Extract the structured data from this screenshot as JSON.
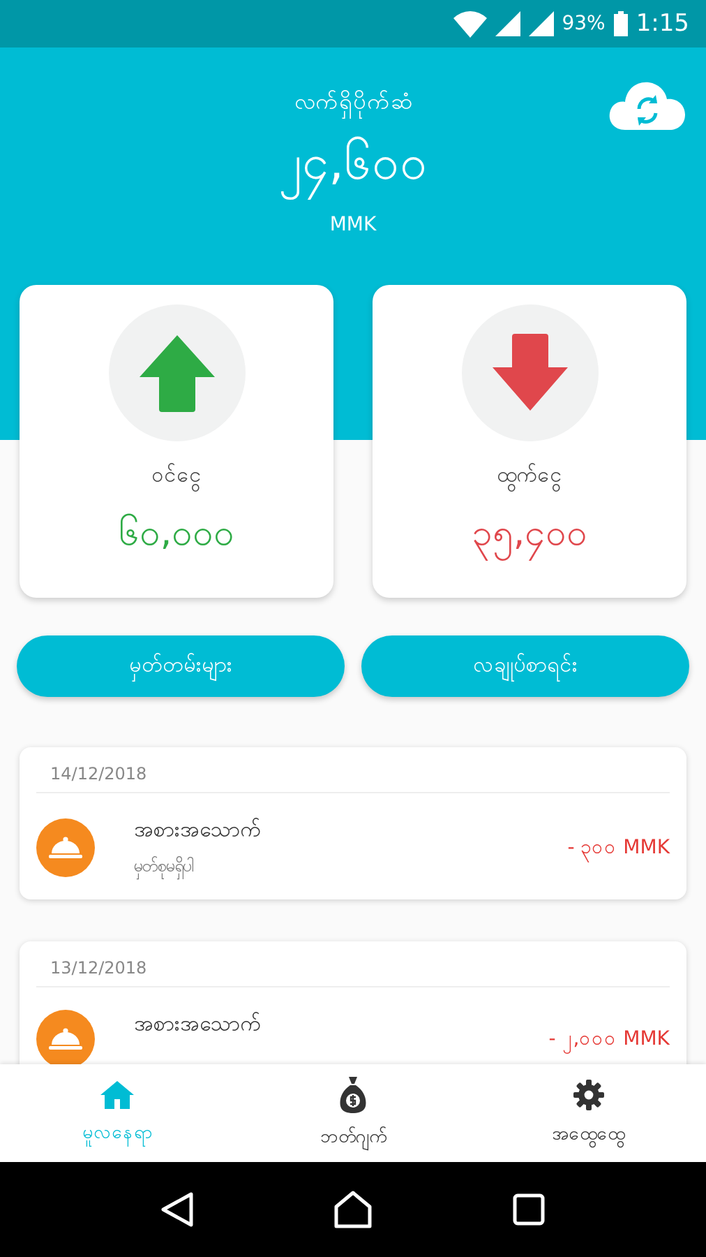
{
  "status_bar": {
    "battery": "93%",
    "time": "1:15"
  },
  "balance": {
    "label": "လက်ရှိပိုက်ဆံ",
    "amount": "၂၄,၆၀၀",
    "currency": "MMK"
  },
  "summary": [
    {
      "kind": "income",
      "label": "ဝင်ငွေ",
      "amount": "၆၀,၀၀၀"
    },
    {
      "kind": "expense",
      "label": "ထွက်ငွေ",
      "amount": "၃၅,၄၀၀"
    }
  ],
  "buttons": [
    "မှတ်တမ်းများ",
    "လချုပ်စာရင်း"
  ],
  "transactions": [
    {
      "date": "14/12/2018",
      "category": "အစားအသောက်",
      "note": "မှတ်စုမရှိပါ",
      "amount": "- ၃၀၀ MMK"
    },
    {
      "date": "13/12/2018",
      "category": "အစားအသောက်",
      "amount": "- ၂,၀၀၀ MMK"
    }
  ],
  "nav": [
    {
      "kind": "home",
      "label": "မူလနေရာ",
      "selected": true
    },
    {
      "kind": "budget",
      "label": "ဘတ်ဂျက်",
      "selected": false
    },
    {
      "kind": "settings",
      "label": "အထွေထွေ",
      "selected": false
    }
  ]
}
